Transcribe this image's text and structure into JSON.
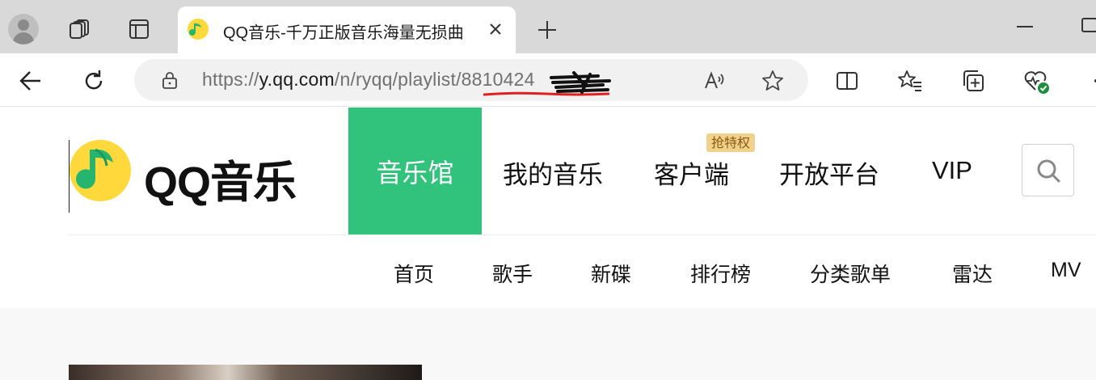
{
  "browser": {
    "tab": {
      "title": "QQ音乐-千万正版音乐海量无损曲"
    },
    "address": {
      "scheme": "https://",
      "host": "y.qq.com",
      "path": "/n/ryqq/playlist/8810424"
    }
  },
  "site": {
    "logo_text": "QQ音乐",
    "main_nav": [
      {
        "label": "音乐馆",
        "active": true
      },
      {
        "label": "我的音乐"
      },
      {
        "label": "客户端"
      },
      {
        "label": "开放平台"
      },
      {
        "label": "VIP"
      }
    ],
    "client_badge": "抢特权",
    "sub_nav": [
      "首页",
      "歌手",
      "新碟",
      "排行榜",
      "分类歌单",
      "雷达",
      "MV"
    ],
    "accent_color": "#31c27c"
  },
  "icons": {
    "profile": "avatar-icon",
    "workspaces": "workspaces-icon",
    "tab_actions": "vertical-tabs-icon",
    "close": "close-icon",
    "new_tab": "plus-icon",
    "back": "back-arrow-icon",
    "refresh": "refresh-icon",
    "lock": "lock-icon",
    "read_aloud": "read-aloud-icon",
    "favorite": "star-icon",
    "split": "split-screen-icon",
    "favorites": "favorites-icon",
    "collections": "collections-icon",
    "health": "browser-essentials-icon",
    "more": "more-icon",
    "search": "search-icon"
  }
}
